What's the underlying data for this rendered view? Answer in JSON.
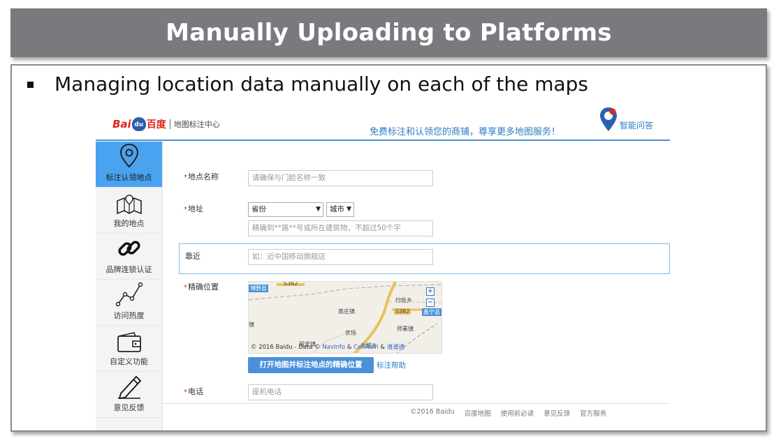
{
  "slide": {
    "title": "Manually Uploading to Platforms",
    "bullet": "Managing location data manually on each of the maps"
  },
  "header": {
    "logo_bai": "Bai",
    "logo_du": "du",
    "logo_baidu_cn": "百度",
    "logo_center": "地图标注中心",
    "slogan": "免费标注和认领您的商铺，尊享更多地图服务！",
    "assistant_label": "智能问答"
  },
  "sidebar": {
    "items": [
      {
        "label": "标注认领地点",
        "icon": "location-pin-icon",
        "active": true
      },
      {
        "label": "我的地点",
        "icon": "folded-map-icon",
        "active": false
      },
      {
        "label": "品牌连锁认证",
        "icon": "chain-link-icon",
        "active": false
      },
      {
        "label": "访问热度",
        "icon": "line-chart-icon",
        "active": false
      },
      {
        "label": "自定义功能",
        "icon": "wallet-icon",
        "active": false
      },
      {
        "label": "意见反馈",
        "icon": "pencil-icon",
        "active": false
      }
    ]
  },
  "form": {
    "name": {
      "label": "地点名称",
      "placeholder": "请确保与门脸名称一致"
    },
    "address": {
      "label": "地址",
      "province": "省份",
      "city": "城市",
      "placeholder": "精确到**路**号或所在建筑物，不超过50个字"
    },
    "nearby": {
      "label": "靠近",
      "placeholder": "如：近中国移动旗舰店"
    },
    "location": {
      "label": "精确位置",
      "map_labels": {
        "county_left": "博野县",
        "road_top": "S382",
        "road_mid": "S382",
        "town_1": "南庄镇",
        "town_2": "付佐乡",
        "town_3": "蠡县",
        "town_4": "镇",
        "town_5": "农场",
        "town_6": "师素镇",
        "town_7": "留史镇",
        "town_8": "北郭乡",
        "county_right": "蠡宁县"
      },
      "map_copyright_prefix": "© 2016 Baidu - Data ©",
      "map_copyright_navinfo": "NavInfo",
      "map_copyright_amp": "&",
      "map_copyright_cennavi": "CenNavi",
      "map_copyright_amp2": "&",
      "map_copyright_daodao": "道道通",
      "open_map_button": "打开地图并标注地点的精确位置",
      "help_link": "标注帮助"
    },
    "phone": {
      "label": "电话",
      "placeholder": "座机电话"
    }
  },
  "footer": {
    "copyright": "©2016 Baidu",
    "links": [
      "百度地图",
      "使用前必读",
      "意见反馈",
      "官方服务"
    ]
  },
  "colors": {
    "title_bar": "#7a7a7e",
    "accent_blue": "#4a90d9",
    "sidebar_active": "#4aa3f0",
    "required_red": "#e2231a"
  }
}
